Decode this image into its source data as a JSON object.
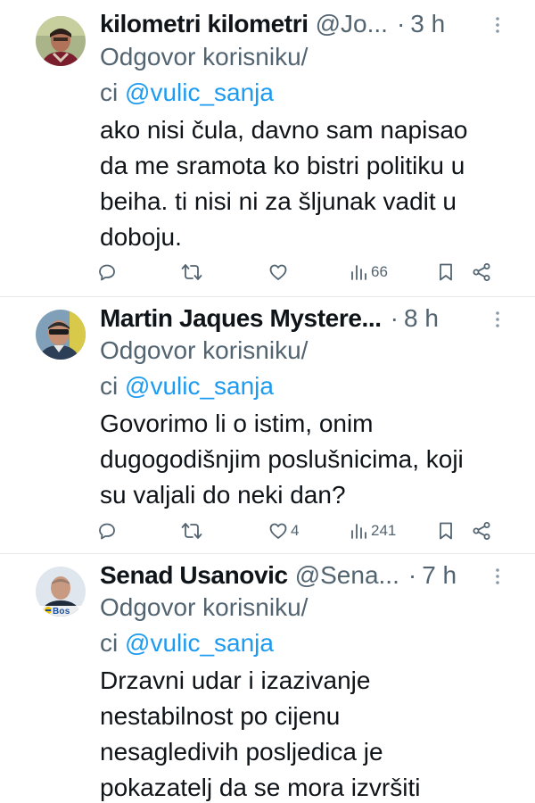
{
  "tweets": [
    {
      "name": "kilometri kilometri",
      "handle": "@Jo...",
      "dot": "·",
      "time": "3 h",
      "reply_prefix": "Odgovor korisniku/",
      "reply_ci": "ci",
      "reply_mention": "@vulic_sanja",
      "lines": [
        "ako nisi čula, davno sam napisao",
        "da me sramota ko bistri politiku u",
        "beiha. ti nisi ni za šljunak vadit u",
        "doboju."
      ],
      "likes": "",
      "views": "66"
    },
    {
      "name": "Martin Jaques Mystere...",
      "handle": "",
      "dot": "·",
      "time": "8 h",
      "reply_prefix": "Odgovor korisniku/",
      "reply_ci": "ci",
      "reply_mention": "@vulic_sanja",
      "lines": [
        "Govorimo li o istim, onim",
        "dugogodišnjim poslušnicima, koji",
        "su valjali do neki dan?"
      ],
      "likes": "4",
      "views": "241"
    },
    {
      "name": "Senad Usanovic",
      "handle": "@Sena...",
      "dot": "·",
      "time": "7 h",
      "reply_prefix": "Odgovor korisniku/",
      "reply_ci": "ci",
      "reply_mention": "@vulic_sanja",
      "lines": [
        "Drzavni udar i izazivanje",
        "nestabilnost po cijenu",
        "nesagledivih posljedica je",
        "pokazatelj da se mora izvršiti"
      ],
      "avatar_badge": "Bos"
    }
  ],
  "colors": {
    "accent": "#1d9bf0",
    "muted": "#536471",
    "text": "#0f1419",
    "divider": "#e6e9eb"
  },
  "icons": [
    "reply-icon",
    "retweet-icon",
    "like-icon",
    "views-icon",
    "bookmark-icon",
    "share-icon",
    "more-icon"
  ]
}
